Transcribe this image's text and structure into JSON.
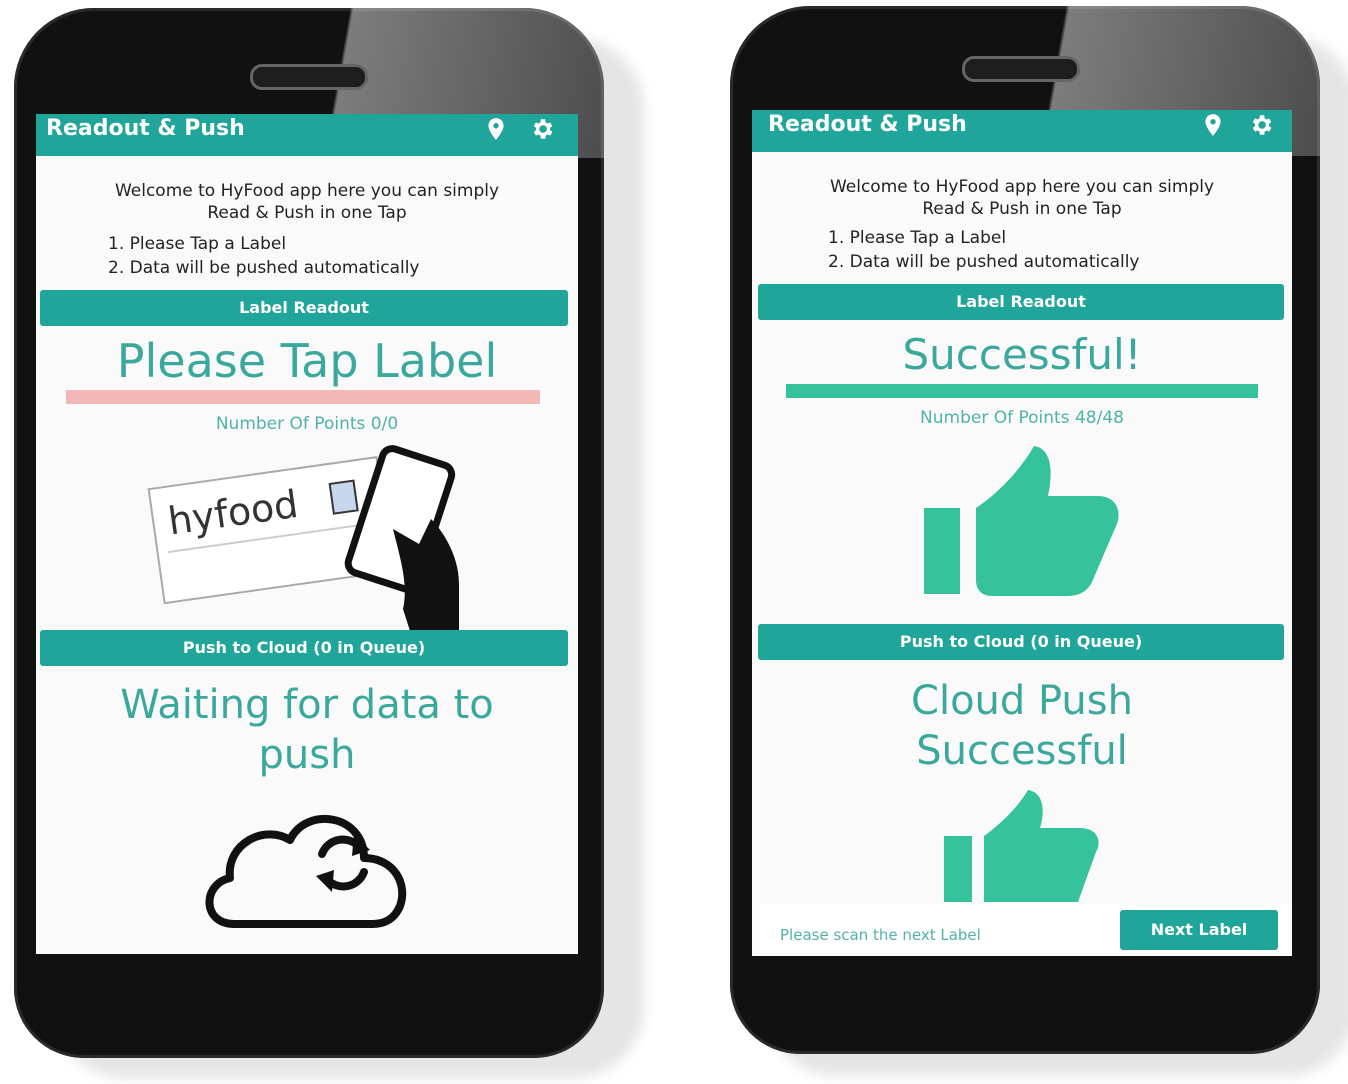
{
  "left_phone": {
    "app_title": "Readout & Push",
    "welcome_line1": "Welcome to HyFood app here you can simply",
    "welcome_line2": "Read & Push in one Tap",
    "step1": "1. Please Tap a Label",
    "step2": "2. Data will be pushed automatically",
    "label_readout_btn": "Label Readout",
    "status_text": "Please Tap Label",
    "progress": 0,
    "progress_color": "#f2b8b8",
    "points_text": "Number Of Points 0/0",
    "card_logo": "hyfood",
    "push_btn": "Push to Cloud  (0 in Queue)",
    "push_status_line1": "Waiting for data to",
    "push_status_line2": "push"
  },
  "right_phone": {
    "app_title": "Readout & Push",
    "welcome_line1": "Welcome to HyFood app here you can simply",
    "welcome_line2": "Read & Push in one Tap",
    "step1": "1. Please Tap a Label",
    "step2": "2. Data will be pushed automatically",
    "label_readout_btn": "Label Readout",
    "status_text": "Successful!",
    "progress": 1,
    "progress_color": "#36c29a",
    "points_text": "Number Of Points 48/48",
    "push_btn": "Push to Cloud  (0 in Queue)",
    "push_status_line1": "Cloud Push",
    "push_status_line2": "Successful",
    "snackbar_text": "Please scan the next Label",
    "snackbar_action": "Next Label"
  },
  "colors": {
    "accent": "#1fa59a",
    "success": "#36c29a",
    "text_teal": "#3aa89d"
  },
  "icons": [
    "location-pin-icon",
    "gear-icon",
    "thumbs-up-icon",
    "cloud-sync-icon",
    "hand-phone-icon"
  ]
}
